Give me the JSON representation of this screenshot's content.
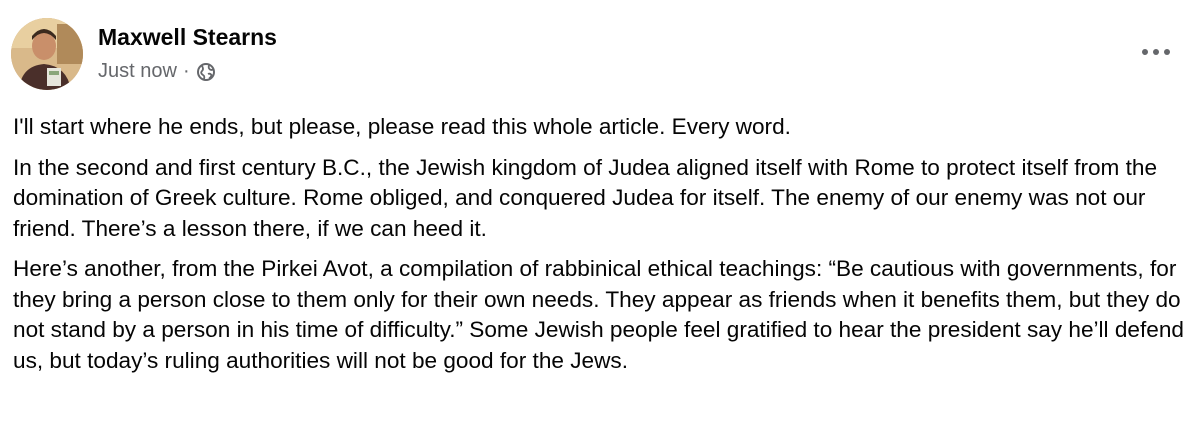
{
  "post": {
    "author": "Maxwell Stearns",
    "timestamp": "Just now",
    "separator": "·",
    "audience_icon": "globe-icon",
    "more_icon": "more-options-icon",
    "paragraphs": [
      "I'll start where he ends, but please, please read this whole article. Every word.",
      "In the second and first century B.C., the Jewish kingdom of Judea aligned itself with Rome to protect itself from the domination of Greek culture. Rome obliged, and conquered Judea for itself. The enemy of our enemy was not our friend. There’s a lesson there, if we can heed it.",
      "Here’s another, from the Pirkei Avot, a compilation of rabbinical ethical teachings: “Be cautious with governments, for they bring a person close to them only for their own needs. They appear as friends when it benefits them, but they do not stand by a person in his time of difficulty.” Some Jewish people feel gratified to hear the president say he’ll defend us, but today’s ruling authorities will not be good for the Jews."
    ]
  },
  "colors": {
    "text_primary": "#050505",
    "text_secondary": "#65676b",
    "background": "#ffffff"
  }
}
